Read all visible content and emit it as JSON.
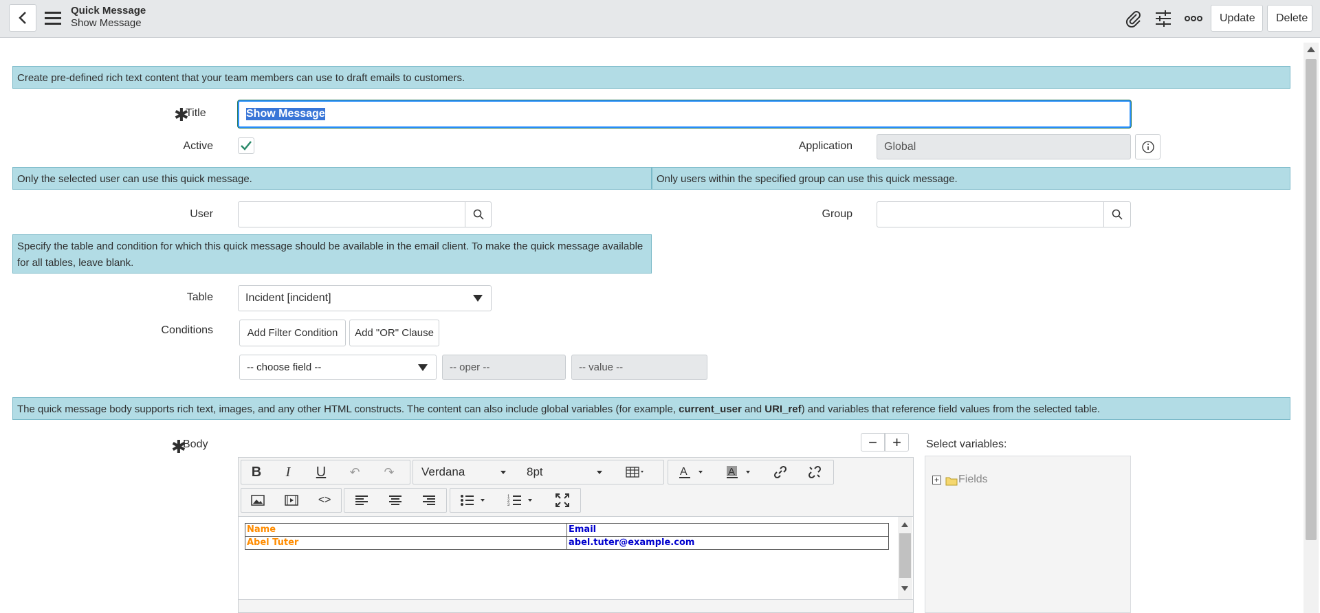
{
  "header": {
    "title": "Quick Message",
    "subtitle": "Show Message",
    "update_label": "Update",
    "delete_label": "Delete"
  },
  "info": {
    "intro": "Create pre-defined rich text content that your team members can use to draft emails to customers.",
    "user_note": "Only the selected user can use this quick message.",
    "group_note": "Only users within the specified group can use this quick message.",
    "table_note": "Specify the table and condition for which this quick message should be available in the email client. To make the quick message available for all tables, leave blank.",
    "body_note_prefix": "The quick message body supports rich text, images, and any other HTML constructs. The content can also include global variables (for example, ",
    "body_note_var1": "current_user",
    "body_note_and": " and ",
    "body_note_var2": "URI_ref",
    "body_note_suffix": ") and variables that reference field values from the selected table."
  },
  "form": {
    "title_label": "Title",
    "title_value": "Show Message",
    "active_label": "Active",
    "active_checked": true,
    "application_label": "Application",
    "application_value": "Global",
    "user_label": "User",
    "user_value": "",
    "group_label": "Group",
    "group_value": "",
    "table_label": "Table",
    "table_value": "Incident [incident]",
    "conditions_label": "Conditions",
    "add_filter_label": "Add Filter Condition",
    "add_or_label": "Add \"OR\" Clause",
    "choose_field": "-- choose field --",
    "oper": "-- oper --",
    "value": "-- value --",
    "body_label": "Body"
  },
  "editor": {
    "font": "Verdana",
    "size": "8pt",
    "table_headers": [
      "Name",
      "Email"
    ],
    "table_row": [
      "Abel Tuter",
      "abel.tuter@example.com"
    ]
  },
  "variables": {
    "label": "Select variables:",
    "fields_label": "Fields"
  },
  "colors": {
    "info_bg": "#b2dce5",
    "orange_text": "#ff8c00",
    "blue_text": "#0000cd",
    "focus_border": "#278efc"
  }
}
